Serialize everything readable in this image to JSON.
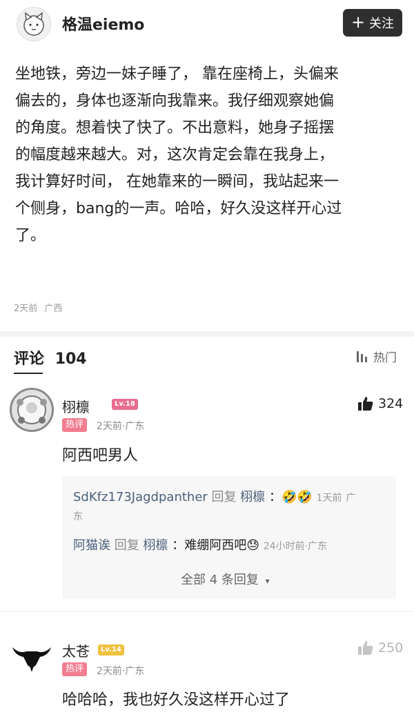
{
  "header": {
    "author": "格温eiemo",
    "follow_label": "关注"
  },
  "post": {
    "lines": [
      "坐地铁，旁边一妹子睡了， 靠在座椅上，头偏来",
      "偏去的，身体也逐渐向我靠来。我仔细观察她偏",
      "的角度。想着快了快了。不出意料，她身子摇摆",
      "的幅度越来越大。对，这次肯定会靠在我身上，",
      "我计算好时间， 在她靠来的一瞬间，我站起来一",
      "个侧身，bang的一声。哈哈，好久没这样开心过",
      "了。"
    ],
    "time": "2天前",
    "location": "广西"
  },
  "comments_header": {
    "title": "评论",
    "count": "104",
    "sort_label": "热门"
  },
  "comments": [
    {
      "name": "栩檩",
      "level": "Lv.18",
      "badge": "热评",
      "time": "2天前",
      "location": "广东",
      "likes": "324",
      "text": "阿西吧男人",
      "replies": [
        {
          "user": "SdKfz173Jagdpanther",
          "reply_word": "回复",
          "target": "栩檩",
          "content": "：🤣🤣",
          "time": "1天前",
          "location": "广东"
        },
        {
          "user": "阿猫诶",
          "reply_word": "回复",
          "target": "栩檩",
          "content": "：难绷阿西吧😓",
          "time": "24小时前",
          "location": "广东"
        }
      ],
      "more_label": "全部 4 条回复"
    },
    {
      "name": "太苍",
      "level": "Lv.14",
      "badge": "热评",
      "time": "2天前",
      "location": "广东",
      "likes": "250",
      "text": "哈哈哈，我也好久没这样开心过了"
    }
  ]
}
